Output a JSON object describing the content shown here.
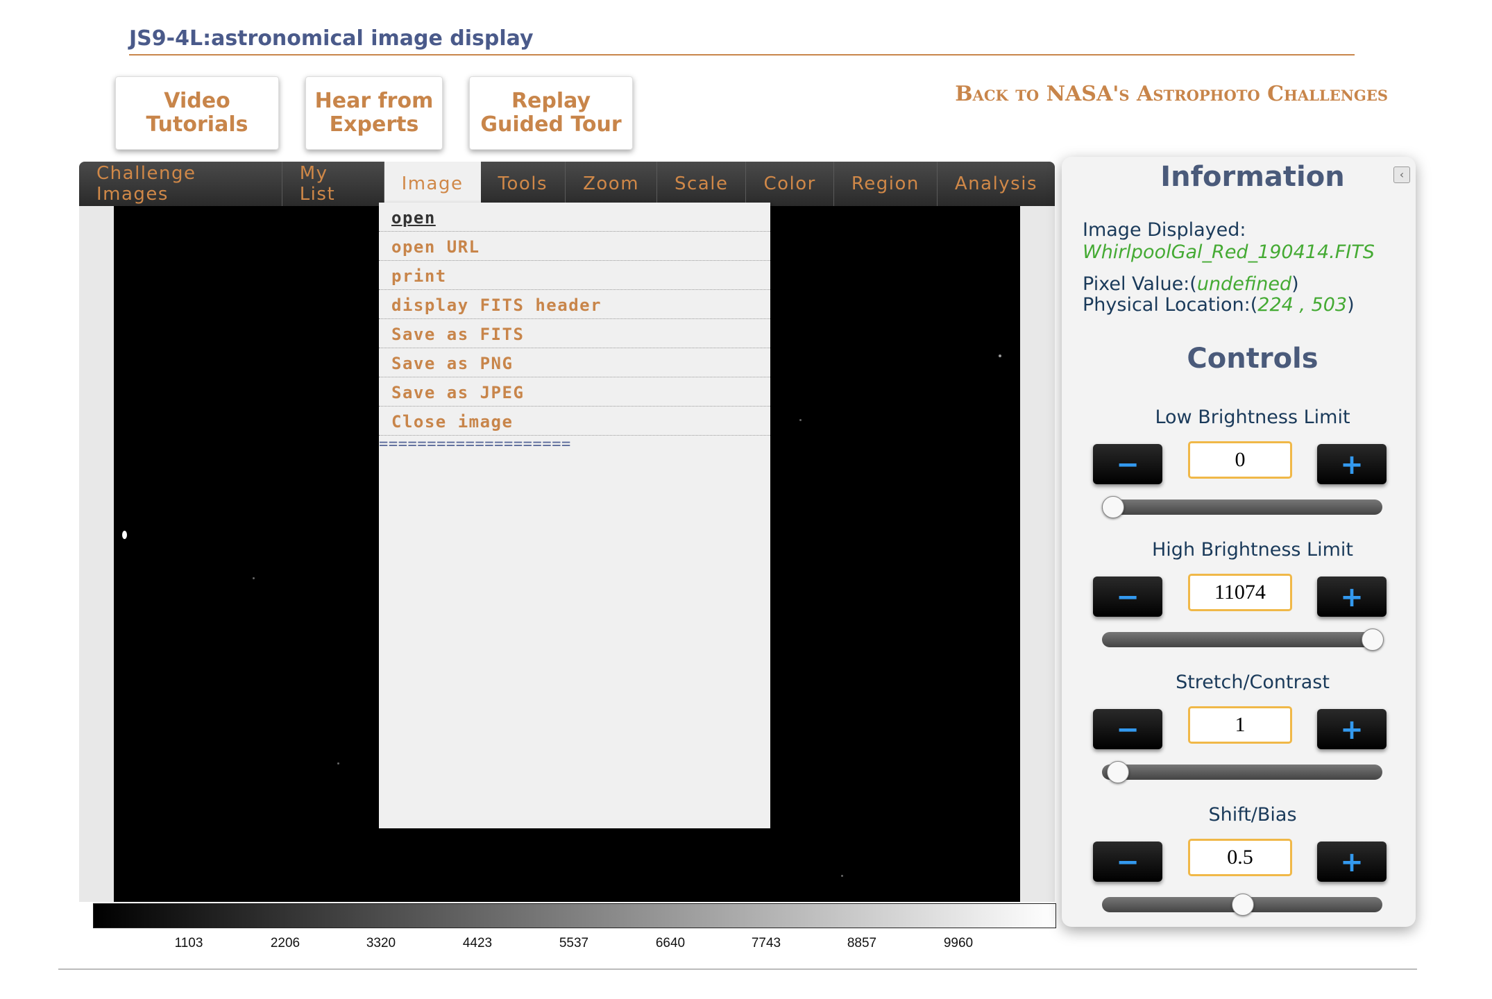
{
  "header": {
    "title": "JS9-4L:astronomical image display",
    "buttons": [
      {
        "line1": "Video",
        "line2": "Tutorials"
      },
      {
        "line1": "Hear from",
        "line2": "Experts"
      },
      {
        "line1": "Replay",
        "line2": "Guided Tour"
      }
    ],
    "back_link": "Back to NASA's Astrophoto Challenges"
  },
  "menubar": {
    "items": [
      "Challenge Images",
      "My List",
      "Image",
      "Tools",
      "Zoom",
      "Scale",
      "Color",
      "Region",
      "Analysis"
    ],
    "active": "Image"
  },
  "image_menu": {
    "items": [
      "open",
      "open URL",
      "print",
      "display FITS header",
      "Save as FITS",
      "Save as PNG",
      "Save as JPEG",
      "Close image"
    ],
    "separator": "===================="
  },
  "colorbar": {
    "ticks": [
      "1103",
      "2206",
      "3320",
      "4423",
      "5537",
      "6640",
      "7743",
      "8857",
      "9960"
    ]
  },
  "info": {
    "heading": "Information",
    "image_label": "Image Displayed:",
    "image_value": "WhirlpoolGal_Red_190414.FITS",
    "pixel_label": "Pixel Value:",
    "pixel_value": "undefined",
    "location_label": "Physical Location:",
    "location_x": "224",
    "location_y": "503"
  },
  "controls": {
    "heading": "Controls",
    "minus_label": "−",
    "plus_label": "+",
    "items": [
      {
        "label": "Low Brightness Limit",
        "value": "0",
        "level": 0.0
      },
      {
        "label": "High Brightness Limit",
        "value": "11074",
        "level": 1.0
      },
      {
        "label": "Stretch/Contrast",
        "value": "1",
        "level": 0.02
      },
      {
        "label": "Shift/Bias",
        "value": "0.5",
        "level": 0.5
      }
    ]
  }
}
